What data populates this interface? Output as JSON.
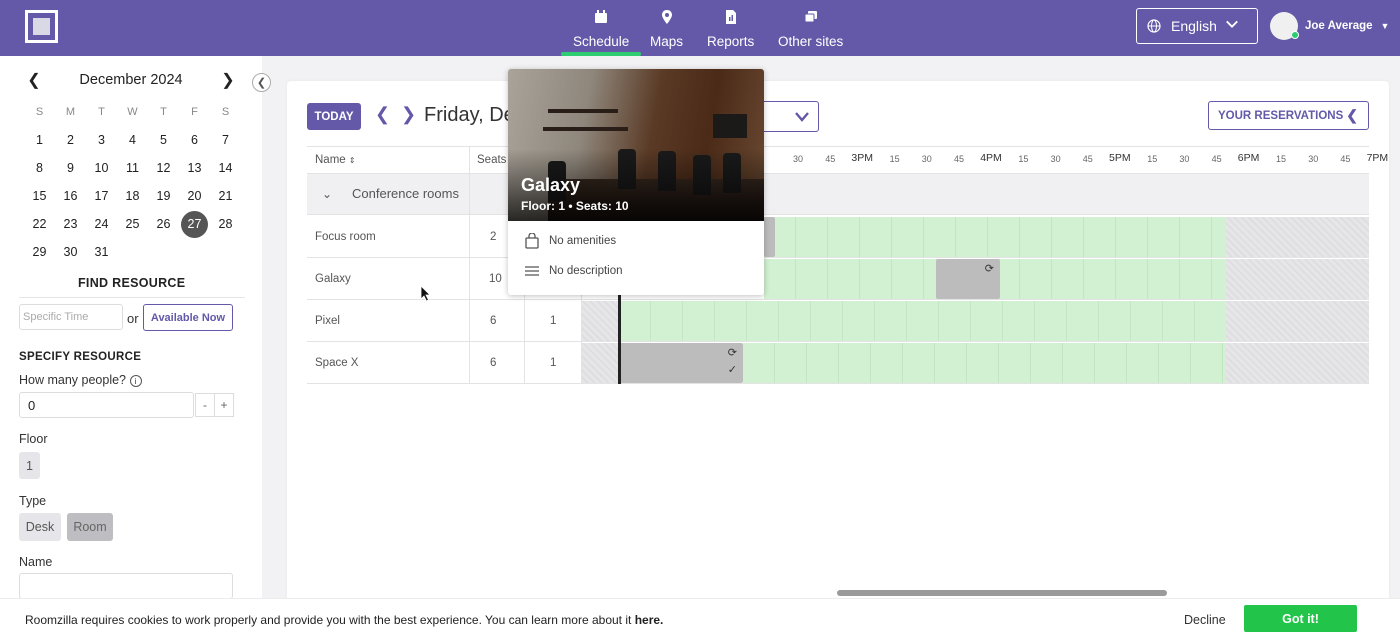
{
  "nav": {
    "items": [
      {
        "label": "Schedule",
        "icon": "calendar-icon",
        "active": true
      },
      {
        "label": "Maps",
        "icon": "map-pin-icon"
      },
      {
        "label": "Reports",
        "icon": "report-icon"
      },
      {
        "label": "Other sites",
        "icon": "sites-icon"
      }
    ],
    "language": "English",
    "user_name": "Joe Average"
  },
  "calendar": {
    "month_label": "December 2024",
    "weekdays": [
      "S",
      "M",
      "T",
      "W",
      "T",
      "F",
      "S"
    ],
    "weeks": [
      [
        "1",
        "2",
        "3",
        "4",
        "5",
        "6",
        "7"
      ],
      [
        "8",
        "9",
        "10",
        "11",
        "12",
        "13",
        "14"
      ],
      [
        "15",
        "16",
        "17",
        "18",
        "19",
        "20",
        "21"
      ],
      [
        "22",
        "23",
        "24",
        "25",
        "26",
        "27",
        "28"
      ],
      [
        "29",
        "30",
        "31",
        "",
        "",
        "",
        ""
      ]
    ],
    "selected_day": "27"
  },
  "find_resource": {
    "title": "FIND RESOURCE",
    "time_placeholder": "Specific Time",
    "or_label": "or",
    "available_now_label": "Available Now"
  },
  "specify_resource": {
    "title": "SPECIFY RESOURCE",
    "people_label": "How many people?",
    "people_value": "0",
    "minus": "-",
    "plus": "+",
    "floor_label": "Floor",
    "floor_value": "1",
    "type_label": "Type",
    "types": [
      "Desk",
      "Room"
    ],
    "selected_type": "Room",
    "name_label": "Name"
  },
  "toolbar": {
    "today_label": "TODAY",
    "date_title": "Friday, De",
    "reservations_label": "YOUR RESERVATIONS"
  },
  "schedule": {
    "col_name": "Name",
    "col_seats": "Seats",
    "time_ticks": [
      {
        "t": "30",
        "big": false
      },
      {
        "t": "45",
        "big": false
      },
      {
        "t": "3PM",
        "big": true
      },
      {
        "t": "15",
        "big": false
      },
      {
        "t": "30",
        "big": false
      },
      {
        "t": "45",
        "big": false
      },
      {
        "t": "4PM",
        "big": true
      },
      {
        "t": "15",
        "big": false
      },
      {
        "t": "30",
        "big": false
      },
      {
        "t": "45",
        "big": false
      },
      {
        "t": "5PM",
        "big": true
      },
      {
        "t": "15",
        "big": false
      },
      {
        "t": "30",
        "big": false
      },
      {
        "t": "45",
        "big": false
      },
      {
        "t": "6PM",
        "big": true
      },
      {
        "t": "15",
        "big": false
      },
      {
        "t": "30",
        "big": false
      },
      {
        "t": "45",
        "big": false
      },
      {
        "t": "7PM",
        "big": true
      }
    ],
    "group": "Conference rooms",
    "rows": [
      {
        "name": "Focus room",
        "seats": "2",
        "floor": ""
      },
      {
        "name": "Galaxy",
        "seats": "10",
        "floor": ""
      },
      {
        "name": "Pixel",
        "seats": "6",
        "floor": "1"
      },
      {
        "name": "Space X",
        "seats": "6",
        "floor": "1"
      }
    ],
    "reservation_icons": {
      "repeat": "⟳",
      "check": "✓"
    }
  },
  "popup": {
    "title": "Galaxy",
    "subtitle": "Floor: 1 • Seats: 10",
    "amenities": "No amenities",
    "description": "No description"
  },
  "cookie": {
    "message": "Roomzilla requires cookies to work properly and provide you with the best experience. You can learn more about it",
    "link": "here.",
    "decline": "Decline",
    "accept": "Got it!"
  },
  "colors": {
    "brand": "#6359a8",
    "available": "#d2f0d2",
    "booked": "#bcbcbc",
    "accept": "#22c44a"
  }
}
